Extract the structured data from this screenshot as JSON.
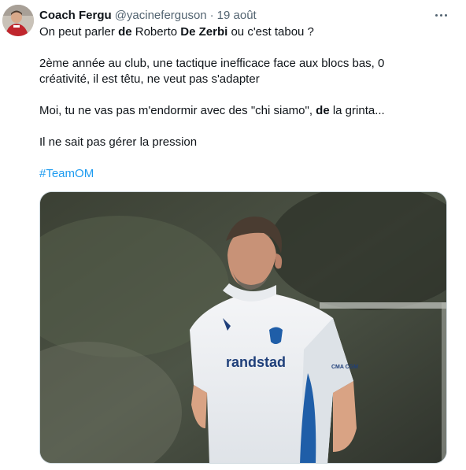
{
  "tweet": {
    "display_name": "Coach Fergu",
    "handle": "@yacineferguson",
    "separator": "·",
    "date": "19 août",
    "line1": {
      "a": "On peut parler ",
      "b": "de",
      "c": " Roberto ",
      "d": "De Zerbi",
      "e": " ou c'est tabou ?"
    },
    "line2": "2ème année au club, une tactique inefficace face aux blocs bas, 0",
    "line3": "créativité, il est têtu, ne veut pas s'adapter",
    "line4": {
      "a": "Moi, tu ne vas pas m'endormir avec des \"chi siamo\", ",
      "b": "de",
      "c": " la grinta..."
    },
    "line5": "Il ne sait pas gérer la pression",
    "hashtag": "#TeamOM",
    "image": {
      "shirt_sponsor": "randstad",
      "shirt_sleeve": "CMA CGM"
    }
  },
  "icons": {
    "more": "more-horizontal-icon"
  }
}
